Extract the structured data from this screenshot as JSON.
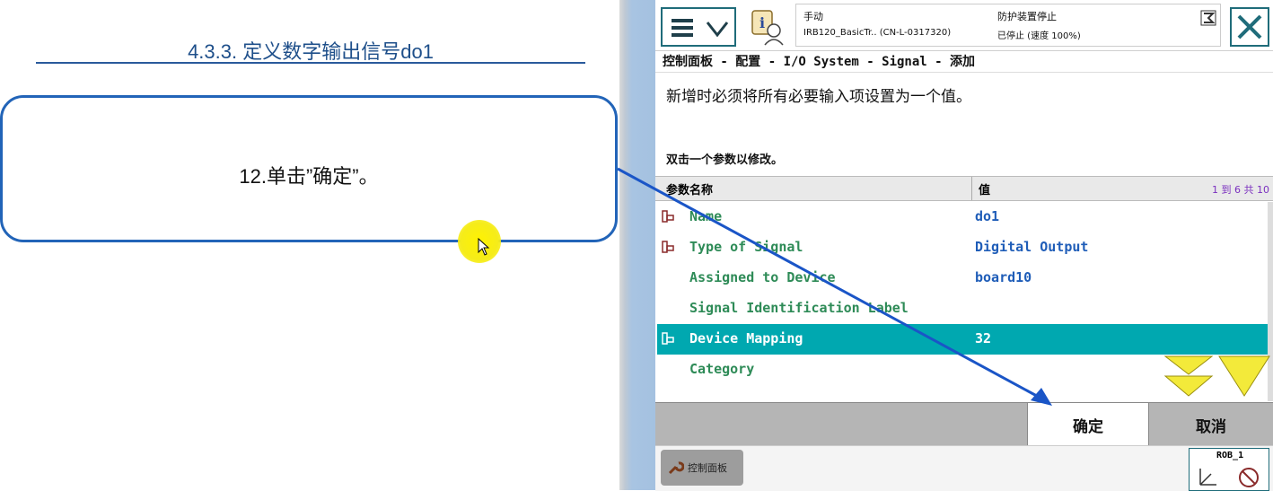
{
  "slide": {
    "title": "4.3.3. 定义数字输出信号do1",
    "step_text": "12.单击”确定”。"
  },
  "status": {
    "mode": "手动",
    "system": "IRB120_BasicTr.. (CN-L-0317320)",
    "safety": "防护装置停止",
    "state": "已停止 (速度 100%)"
  },
  "breadcrumb": "控制面板 - 配置 - I/O System - Signal - 添加",
  "instructions": {
    "line1": "新增时必须将所有必要输入项设置为一个值。",
    "line2": "双击一个参数以修改。"
  },
  "table": {
    "col_name": "参数名称",
    "col_value": "值",
    "count": "1 到 6 共 10",
    "rows": [
      {
        "name": "Name",
        "value": "do1",
        "icon": "required-param-icon",
        "selected": false
      },
      {
        "name": "Type of Signal",
        "value": "Digital Output",
        "icon": "required-param-icon",
        "selected": false
      },
      {
        "name": "Assigned to Device",
        "value": "board10",
        "icon": "",
        "selected": false
      },
      {
        "name": "Signal Identification Label",
        "value": "",
        "icon": "",
        "selected": false
      },
      {
        "name": "Device Mapping",
        "value": "32",
        "icon": "required-param-icon",
        "selected": true
      },
      {
        "name": "Category",
        "value": "",
        "icon": "",
        "selected": false
      }
    ]
  },
  "buttons": {
    "ok": "确定",
    "cancel": "取消"
  },
  "taskbar": {
    "control_panel": "控制面板",
    "robot": "ROB_1"
  },
  "colors": {
    "accent": "#00a8b0",
    "param_name": "#2e8b57",
    "param_value": "#1f5db8",
    "callout_border": "#2264b8",
    "pointer_arrow": "#1a55c7"
  },
  "icons": [
    "menu-icon",
    "chevron-down-icon",
    "status-info-icon",
    "hold-to-run-icon",
    "close-icon",
    "scroll-down-double-icon",
    "scroll-down-icon",
    "wrench-icon",
    "jog-axes-icon"
  ]
}
